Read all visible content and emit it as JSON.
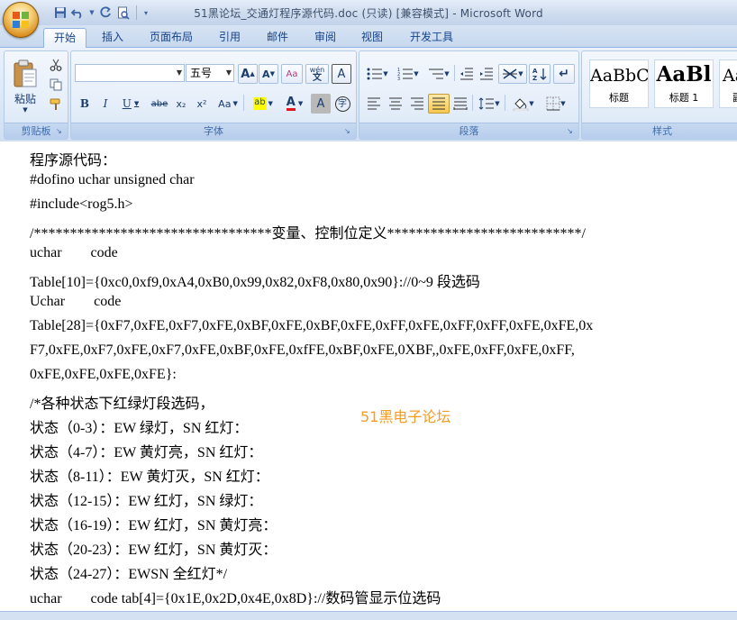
{
  "window": {
    "title": "51黑论坛_交通灯程序源代码.doc (只读) [兼容模式] - Microsoft Word"
  },
  "quick_access": {
    "icons": [
      "save-icon",
      "undo-icon",
      "redo-icon",
      "print-preview-icon",
      "customize-icon"
    ]
  },
  "tabs": [
    {
      "label": "开始",
      "active": true
    },
    {
      "label": "插入"
    },
    {
      "label": "页面布局"
    },
    {
      "label": "引用"
    },
    {
      "label": "邮件"
    },
    {
      "label": "审阅"
    },
    {
      "label": "视图"
    },
    {
      "label": "开发工具"
    }
  ],
  "ribbon": {
    "clipboard": {
      "label": "剪贴板",
      "paste_label": "粘贴"
    },
    "font": {
      "label": "字体",
      "font_name": "",
      "font_size": "五号",
      "grow": "A",
      "shrink": "A",
      "clear_format": "Aa",
      "phonetic": "wén",
      "border_char": "A",
      "bold": "B",
      "italic": "I",
      "underline": "U",
      "strike": "abe",
      "subscript": "x₂",
      "superscript": "x²",
      "change_case": "Aa",
      "highlight": "ab",
      "font_color": "A",
      "shade_char": "A",
      "enclose_char": "字"
    },
    "paragraph": {
      "label": "段落"
    },
    "styles": {
      "label": "样式",
      "cards": [
        {
          "sample": "AaBbC",
          "name": "标题"
        },
        {
          "sample": "AaBl",
          "name": "标题 1"
        },
        {
          "sample": "Aa",
          "name": "副"
        }
      ]
    }
  },
  "document": {
    "lines": [
      "程序源代码：",
      "#dofino uchar unsigned char",
      "#include<rog5.h>",
      "/*********************************变量、控制位定义***************************/",
      "uchar        code",
      "Table[10]={0xc0,0xf9,0xA4,0xB0,0x99,0x82,0xF8,0x80,0x90}://0~9 段选码",
      "Uchar        code",
      "Table[28]={0xF7,0xFE,0xF7,0xFE,0xBF,0xFE,0xBF,0xFE,0xFF,0xFE,0xFF,0xFF,0xFE,0xFE,0x",
      "F7,0xFE,0xF7,0xFE,0xF7,0xFE,0xBF,0xFE,0xfFE,0xBF,0xFE,0XBF,,0xFE,0xFF,0xFE,0xFF,",
      "0xFE,0xFE,0xFE,0xFE}:",
      "/*各种状态下红绿灯段选码，",
      "状态（0-3）：EW 绿灯，SN 红灯：",
      "状态（4-7）：EW 黄灯亮，SN 红灯：",
      "状态（8-11）：EW 黄灯灭，SN 红灯：",
      "状态（12-15）：EW 红灯，SN 绿灯：",
      "状态（16-19）：EW 红灯，SN 黄灯亮：",
      "状态（20-23）：EW 红灯，SN 黄灯灭：",
      "状态（24-27）：EWSN 全红灯*/",
      "uchar        code tab[4]={0x1E,0x2D,0x4E,0x8D}://数码管显示位选码"
    ],
    "watermark": "51黑电子论坛"
  },
  "colors": {
    "ribbon_bg": "#dbe7f6",
    "tab_text": "#15428b",
    "watermark": "#f39c26"
  }
}
